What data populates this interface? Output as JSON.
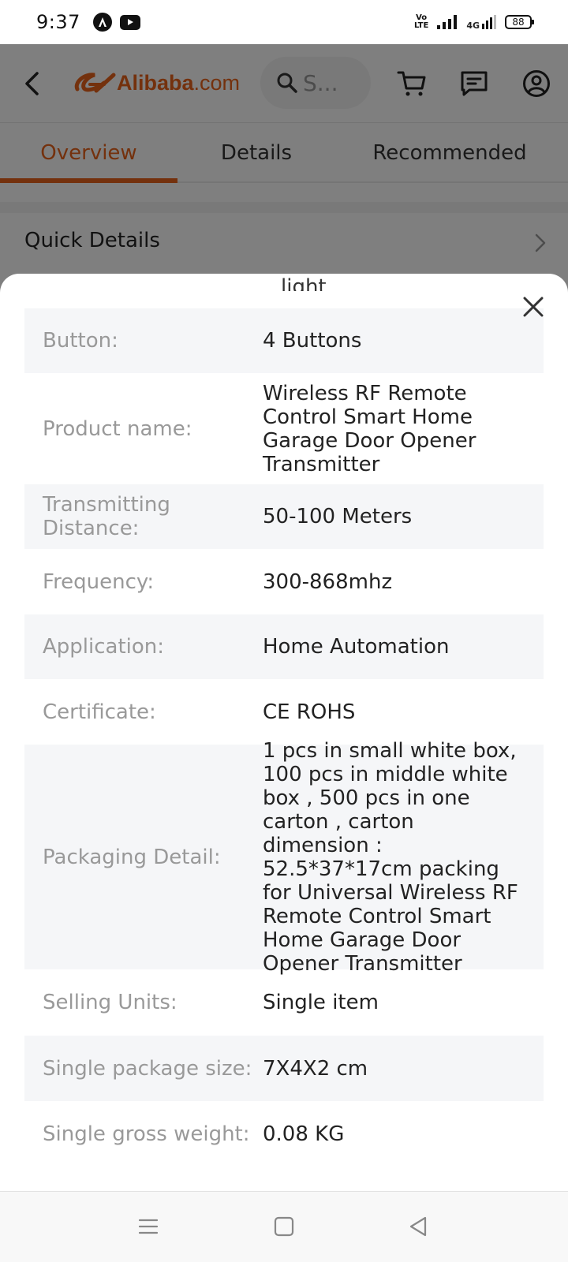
{
  "status_bar": {
    "time": "9:37",
    "network_label_top": "Vo",
    "network_label_bottom": "LTE",
    "network_type": "4G",
    "battery": "88"
  },
  "header": {
    "logo_text": "Alibaba",
    "logo_suffix": ".com",
    "search_placeholder": "S..."
  },
  "tabs": [
    {
      "label": "Overview",
      "active": true
    },
    {
      "label": "Details",
      "active": false
    },
    {
      "label": "Recommended",
      "active": false
    }
  ],
  "quick_details_title": "Quick Details",
  "sheet": {
    "partial_text": "light",
    "specs": [
      {
        "label": "Button:",
        "value": "4 Buttons"
      },
      {
        "label": "Product name:",
        "value": "Wireless RF Remote Control Smart Home Garage Door Opener Transmitter"
      },
      {
        "label": "Transmitting Distance:",
        "value": "50-100 Meters"
      },
      {
        "label": "Frequency:",
        "value": "300-868mhz"
      },
      {
        "label": "Application:",
        "value": "Home Automation"
      },
      {
        "label": "Certificate:",
        "value": "CE ROHS"
      },
      {
        "label": "Packaging Detail:",
        "value": "1 pcs in small white box, 100 pcs in middle white box , 500 pcs in one carton , carton dimension : 52.5*37*17cm packing for Universal Wireless RF Remote Control Smart Home Garage Door Opener Transmitter"
      },
      {
        "label": "Selling Units:",
        "value": "Single item"
      },
      {
        "label": "Single package size:",
        "value": "7X4X2 cm"
      },
      {
        "label": "Single gross weight:",
        "value": "0.08 KG"
      }
    ]
  },
  "colors": {
    "accent": "#e8631a",
    "overlay": "rgba(0,0,0,0.5)",
    "row_shade": "#f5f6f8"
  },
  "icons": {
    "back": "chevron-left-icon",
    "search": "search-icon",
    "cart": "cart-icon",
    "messages": "message-icon",
    "account": "user-icon",
    "close": "close-icon",
    "nav_menu": "menu-icon",
    "nav_home": "square-icon",
    "nav_back": "triangle-back-icon"
  }
}
